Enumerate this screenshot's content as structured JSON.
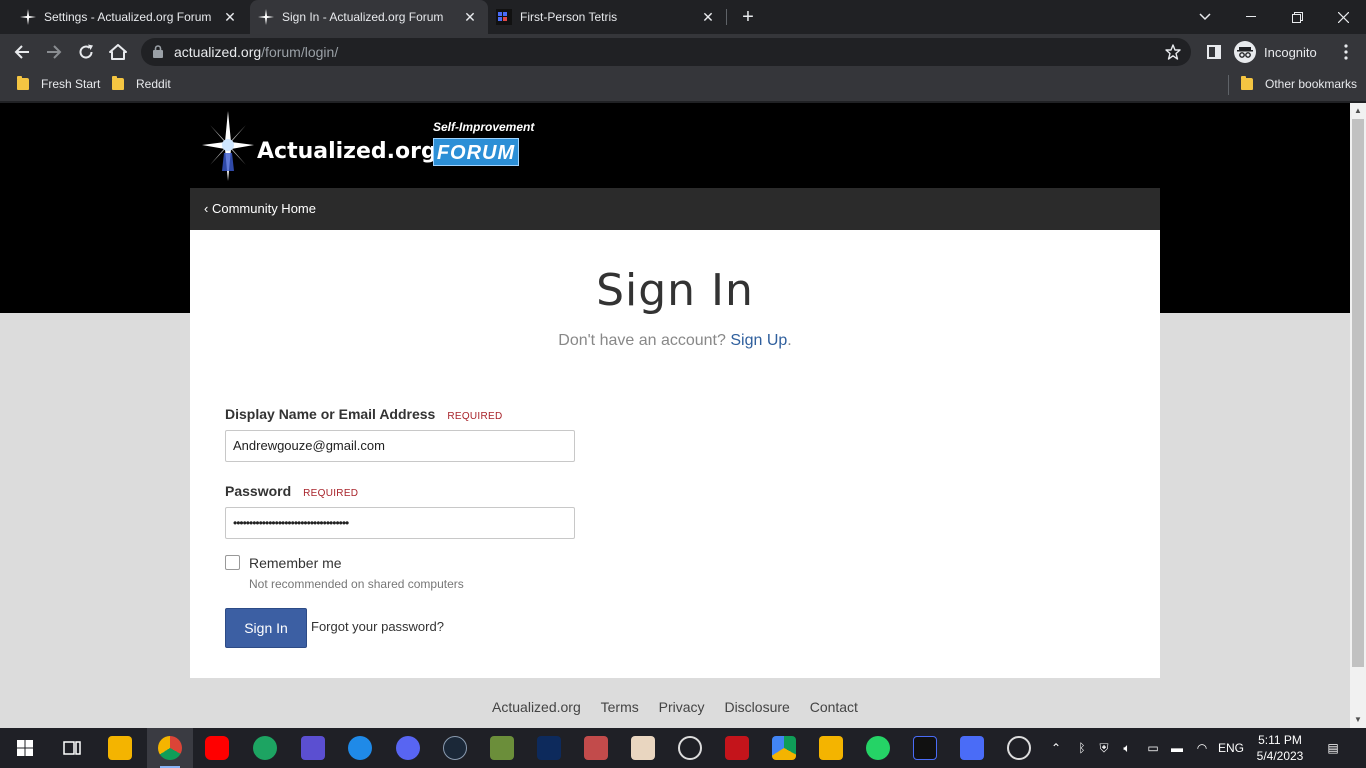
{
  "browser": {
    "tabs": [
      {
        "title": "Settings - Actualized.org Forum",
        "active": false
      },
      {
        "title": "Sign In - Actualized.org Forum",
        "active": true
      },
      {
        "title": "First-Person Tetris",
        "active": false
      }
    ],
    "url_host": "actualized.org",
    "url_path": "/forum/login/",
    "profile_label": "Incognito",
    "bookmarks": [
      "Fresh Start",
      "Reddit"
    ],
    "other_bookmarks": "Other bookmarks"
  },
  "site": {
    "logo_name": "Actualized.org",
    "logo_tagline": "Self-Improvement",
    "logo_badge": "FORUM",
    "nav_home": "Community Home"
  },
  "login": {
    "title": "Sign In",
    "no_account": "Don't have an account?",
    "signup_link": "Sign Up",
    "signup_period": ".",
    "email_label": "Display Name or Email Address",
    "required": "REQUIRED",
    "email_value": "Andrewgouze@gmail.com",
    "password_label": "Password",
    "password_value": "••••••••••••••••••••••••••••••••••••",
    "remember_label": "Remember me",
    "remember_note": "Not recommended on shared computers",
    "submit_label": "Sign In",
    "forgot_label": "Forgot your password?"
  },
  "footer": {
    "links": [
      "Actualized.org",
      "Terms",
      "Privacy",
      "Disclosure",
      "Contact"
    ]
  },
  "taskbar": {
    "language": "ENG",
    "time": "5:11 PM",
    "date": "5/4/2023"
  },
  "colors": {
    "brand_blue": "#3c5fa3",
    "link_blue": "#2f5f9d",
    "required_red": "#a8232a",
    "browser_dark": "#202124"
  }
}
